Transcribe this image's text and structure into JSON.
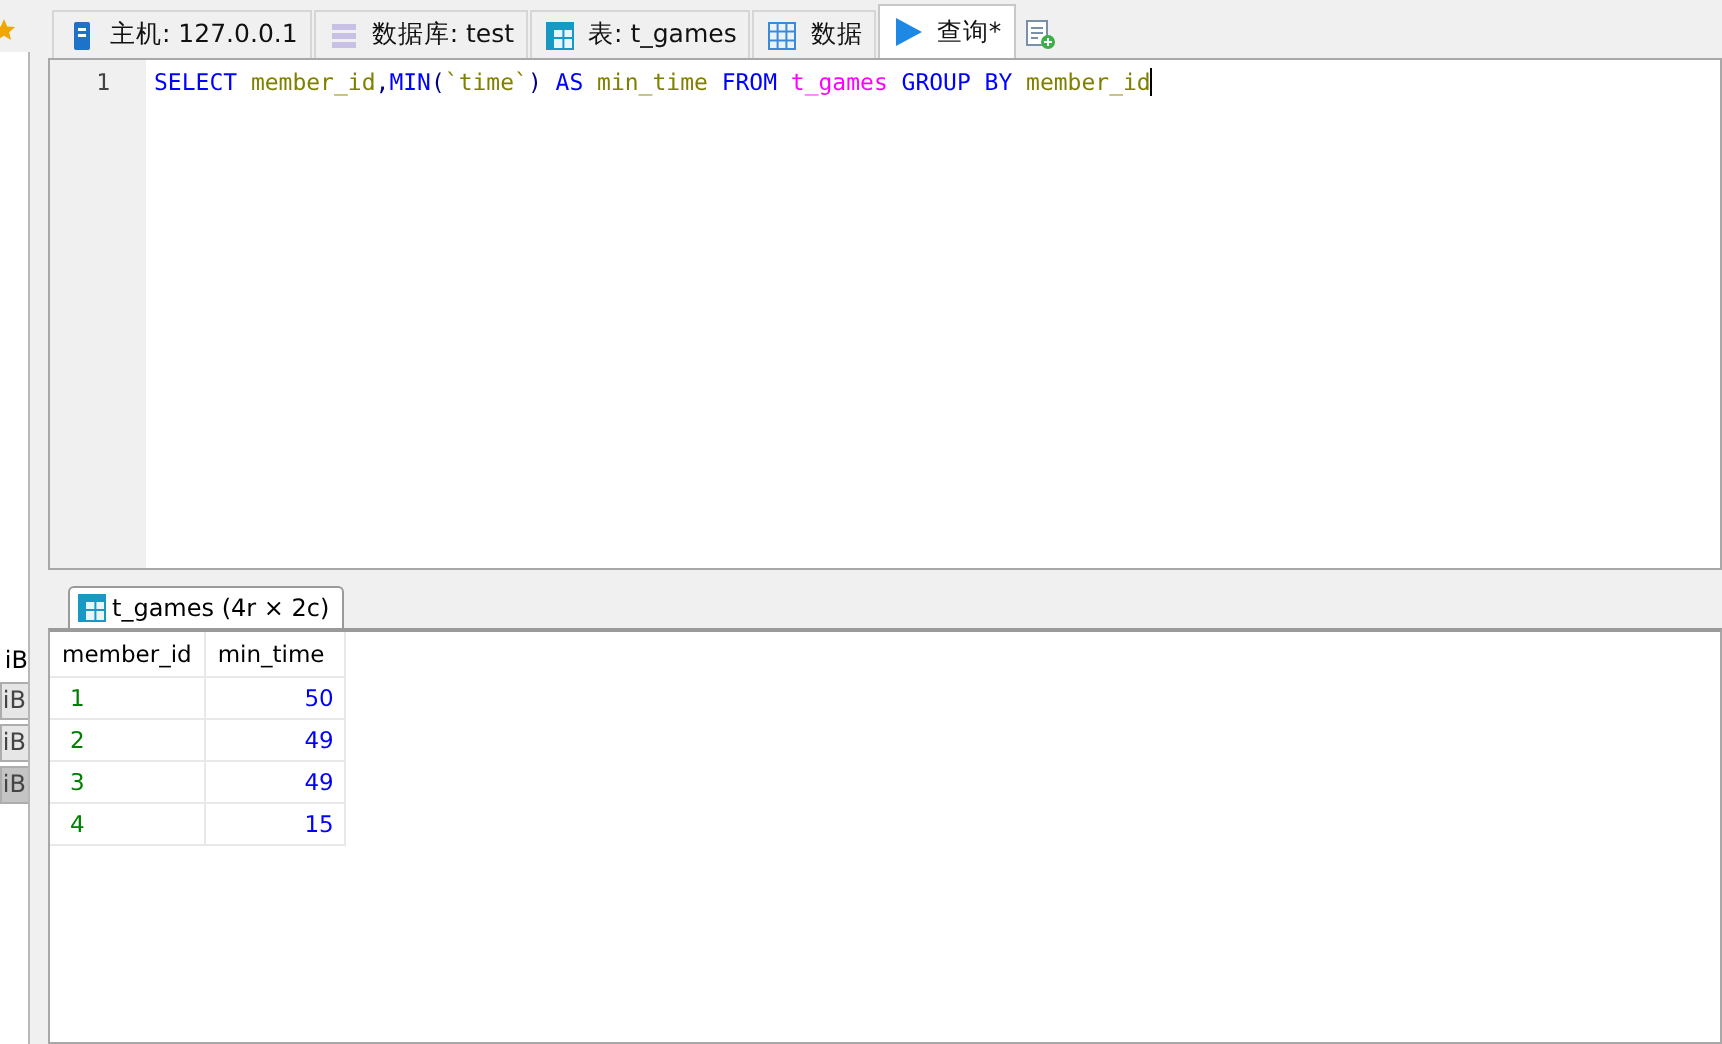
{
  "sidebar": {
    "items": [
      {
        "label": "iB",
        "kind": "text",
        "selected": false
      },
      {
        "label": "iB",
        "kind": "button",
        "selected": false
      },
      {
        "label": "iB",
        "kind": "button",
        "selected": false
      },
      {
        "label": "iB",
        "kind": "button",
        "selected": true
      }
    ]
  },
  "tabs": [
    {
      "label": "主机: 127.0.0.1",
      "kind": "server",
      "selected": false
    },
    {
      "label": "数据库: test",
      "kind": "database",
      "selected": false
    },
    {
      "label": "表: t_games",
      "kind": "table",
      "selected": false
    },
    {
      "label": "数据",
      "kind": "grid",
      "selected": false
    },
    {
      "label": "查询*",
      "kind": "query",
      "selected": true
    }
  ],
  "editor": {
    "lines": [
      {
        "number": "1",
        "tokens": [
          {
            "text": "SELECT",
            "kind": "keyword",
            "gap": false
          },
          {
            "text": "member_id",
            "kind": "identifier",
            "gap": true
          },
          {
            "text": ",",
            "kind": "punct",
            "gap": false
          },
          {
            "text": "MIN",
            "kind": "keyword",
            "gap": false
          },
          {
            "text": "(",
            "kind": "punct",
            "gap": false
          },
          {
            "text": "`time`",
            "kind": "identifier",
            "gap": false
          },
          {
            "text": ")",
            "kind": "punct",
            "gap": false
          },
          {
            "text": "AS",
            "kind": "keyword",
            "gap": true
          },
          {
            "text": "min_time",
            "kind": "identifier",
            "gap": true
          },
          {
            "text": "FROM",
            "kind": "keyword",
            "gap": true
          },
          {
            "text": "t_games",
            "kind": "table",
            "gap": true
          },
          {
            "text": "GROUP",
            "kind": "keyword",
            "gap": true
          },
          {
            "text": "BY",
            "kind": "keyword",
            "gap": true
          },
          {
            "text": "member_id",
            "kind": "identifier",
            "gap": true
          }
        ]
      }
    ]
  },
  "result": {
    "tab": {
      "label": "t_games (4r × 2c)",
      "selected": true
    },
    "columns": [
      "member_id",
      "min_time"
    ],
    "rows": [
      [
        "1",
        "50"
      ],
      [
        "2",
        "49"
      ],
      [
        "3",
        "49"
      ],
      [
        "4",
        "15"
      ]
    ]
  }
}
